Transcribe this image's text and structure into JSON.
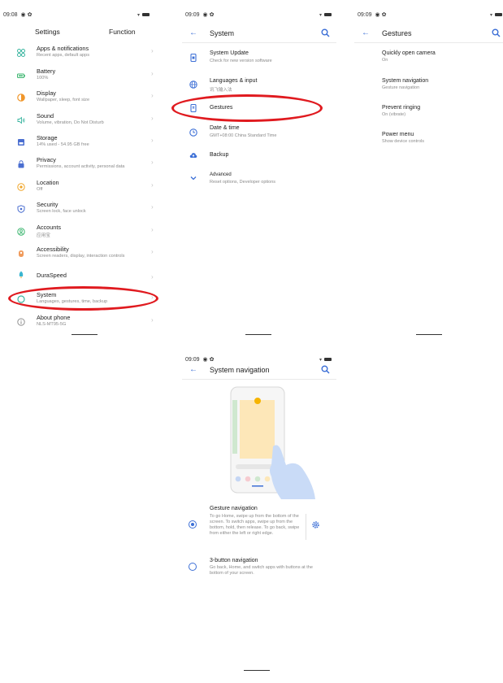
{
  "colors": {
    "accent": "#3c6fd6",
    "annotation": "#e01a1f"
  },
  "settings": {
    "time": "09:08",
    "tabs": [
      "Settings",
      "Function"
    ],
    "items": [
      {
        "icon": "apps-icon",
        "title": "Apps & notifications",
        "subtitle": "Recent apps, default apps"
      },
      {
        "icon": "battery-icon",
        "title": "Battery",
        "subtitle": "100%"
      },
      {
        "icon": "display-icon",
        "title": "Display",
        "subtitle": "Wallpaper, sleep, font size"
      },
      {
        "icon": "sound-icon",
        "title": "Sound",
        "subtitle": "Volume, vibration, Do Not Disturb"
      },
      {
        "icon": "storage-icon",
        "title": "Storage",
        "subtitle": "14% used - 54.95 GB free"
      },
      {
        "icon": "privacy-icon",
        "title": "Privacy",
        "subtitle": "Permissions, account activity, personal data"
      },
      {
        "icon": "location-icon",
        "title": "Location",
        "subtitle": "Off"
      },
      {
        "icon": "security-icon",
        "title": "Security",
        "subtitle": "Screen lock, face unlock"
      },
      {
        "icon": "accounts-icon",
        "title": "Accounts",
        "subtitle": "应用宝"
      },
      {
        "icon": "accessibility-icon",
        "title": "Accessibility",
        "subtitle": "Screen readers, display, interaction controls"
      },
      {
        "icon": "duraspeed-icon",
        "title": "DuraSpeed",
        "subtitle": ""
      },
      {
        "icon": "system-icon",
        "title": "System",
        "subtitle": "Languages, gestures, time, backup"
      },
      {
        "icon": "about-icon",
        "title": "About phone",
        "subtitle": "NLS-MT95-5G"
      }
    ]
  },
  "system": {
    "time": "09:09",
    "title": "System",
    "items": [
      {
        "icon": "system-update-icon",
        "title": "System Update",
        "subtitle": "Check for new version software"
      },
      {
        "icon": "language-icon",
        "title": "Languages & input",
        "subtitle": "讯飞输入法"
      },
      {
        "icon": "gestures-icon",
        "title": "Gestures",
        "subtitle": ""
      },
      {
        "icon": "clock-icon",
        "title": "Date & time",
        "subtitle": "GMT+08:00 China Standard Time"
      },
      {
        "icon": "backup-icon",
        "title": "Backup",
        "subtitle": ""
      },
      {
        "icon": "chevron-down-icon",
        "title": "Advanced",
        "subtitle": "Reset options, Developer options"
      }
    ]
  },
  "gestures": {
    "time": "09:09",
    "title": "Gestures",
    "items": [
      {
        "title": "Quickly open camera",
        "subtitle": "On"
      },
      {
        "title": "System navigation",
        "subtitle": "Gesture navigation"
      },
      {
        "title": "Prevent ringing",
        "subtitle": "On (vibrate)"
      },
      {
        "title": "Power menu",
        "subtitle": "Show device controls"
      }
    ]
  },
  "navigation": {
    "time": "09:09",
    "title": "System navigation",
    "options": [
      {
        "title": "Gesture navigation",
        "subtitle": "To go Home, swipe up from the bottom of the screen. To switch apps, swipe up from the bottom, hold, then release. To go back, swipe from either the left or right edge.",
        "selected": true
      },
      {
        "title": "3-button navigation",
        "subtitle": "Go back, Home, and switch apps with buttons at the bottom of your screen.",
        "selected": false
      }
    ]
  }
}
